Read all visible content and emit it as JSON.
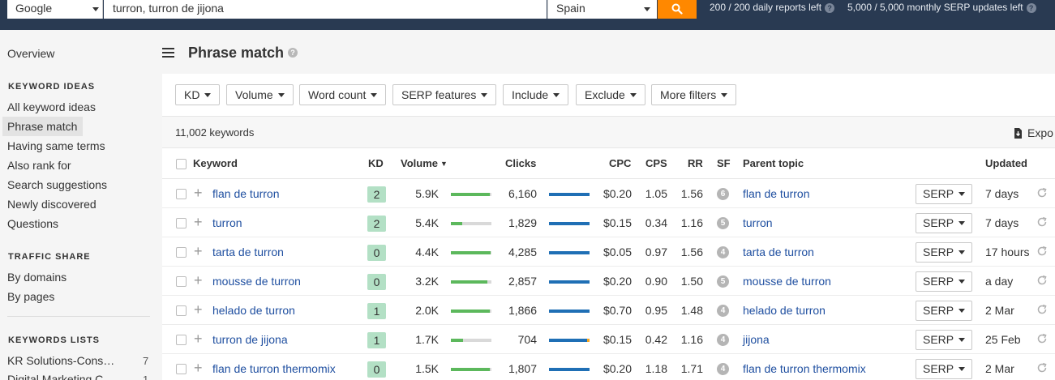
{
  "topbar": {
    "engine": "Google",
    "query": "turron, turron de jijona",
    "country": "Spain",
    "daily_reports": "200 / 200 daily reports left",
    "monthly_updates": "5,000 / 5,000 monthly SERP updates left",
    "help_mark": "?"
  },
  "sidebar": {
    "overview": "Overview",
    "keyword_ideas_heading": "KEYWORD IDEAS",
    "keyword_ideas": [
      "All keyword ideas",
      "Phrase match",
      "Having same terms",
      "Also rank for",
      "Search suggestions",
      "Newly discovered",
      "Questions"
    ],
    "active_item": "Phrase match",
    "traffic_share_heading": "TRAFFIC SHARE",
    "traffic_share": [
      "By domains",
      "By pages"
    ],
    "keyword_lists_heading": "KEYWORDS LISTS",
    "keyword_lists": [
      {
        "name": "KR Solutions-Cons…",
        "count": "7"
      },
      {
        "name": "Digital Marketing C…",
        "count": "1"
      }
    ]
  },
  "page": {
    "title": "Phrase match",
    "help_mark": "?"
  },
  "filters": [
    "KD",
    "Volume",
    "Word count",
    "SERP features",
    "Include",
    "Exclude",
    "More filters"
  ],
  "results": {
    "count": "11,002 keywords",
    "export_label": "Expo"
  },
  "table": {
    "headers": {
      "keyword": "Keyword",
      "kd": "KD",
      "volume": "Volume",
      "clicks": "Clicks",
      "cpc": "CPC",
      "cps": "CPS",
      "rr": "RR",
      "sf": "SF",
      "parent_topic": "Parent topic",
      "updated": "Updated"
    },
    "serp_label": "SERP",
    "rows": [
      {
        "keyword": "flan de turron",
        "kd": "2",
        "volume": "5.9K",
        "volume_level": 0.96,
        "clicks": "6,160",
        "paid_share": 0.0,
        "cpc": "$0.20",
        "cps": "1.05",
        "rr": "1.56",
        "sf": "6",
        "parent": "flan de turron",
        "updated": "7 days"
      },
      {
        "keyword": "turron",
        "kd": "2",
        "volume": "5.4K",
        "volume_level": 0.27,
        "clicks": "1,829",
        "paid_share": 0.0,
        "cpc": "$0.15",
        "cps": "0.34",
        "rr": "1.16",
        "sf": "5",
        "parent": "turron",
        "updated": "7 days"
      },
      {
        "keyword": "tarta de turron",
        "kd": "0",
        "volume": "4.4K",
        "volume_level": 0.97,
        "clicks": "4,285",
        "paid_share": 0.0,
        "cpc": "$0.05",
        "cps": "0.97",
        "rr": "1.56",
        "sf": "4",
        "parent": "tarta de turron",
        "updated": "17 hours"
      },
      {
        "keyword": "mousse de turron",
        "kd": "0",
        "volume": "3.2K",
        "volume_level": 0.89,
        "clicks": "2,857",
        "paid_share": 0.0,
        "cpc": "$0.20",
        "cps": "0.90",
        "rr": "1.50",
        "sf": "5",
        "parent": "mousse de turron",
        "updated": "a day"
      },
      {
        "keyword": "helado de turron",
        "kd": "1",
        "volume": "2.0K",
        "volume_level": 0.95,
        "clicks": "1,866",
        "paid_share": 0.0,
        "cpc": "$0.70",
        "cps": "0.95",
        "rr": "1.48",
        "sf": "4",
        "parent": "helado de turron",
        "updated": "2 Mar"
      },
      {
        "keyword": "turron de jijona",
        "kd": "1",
        "volume": "1.7K",
        "volume_level": 0.3,
        "clicks": "704",
        "paid_share": 0.06,
        "cpc": "$0.15",
        "cps": "0.42",
        "rr": "1.16",
        "sf": "4",
        "parent": "jijona",
        "updated": "25 Feb"
      },
      {
        "keyword": "flan de turron thermomix",
        "kd": "0",
        "volume": "1.5K",
        "volume_level": 0.96,
        "clicks": "1,807",
        "paid_share": 0.0,
        "cpc": "$0.20",
        "cps": "1.18",
        "rr": "1.71",
        "sf": "4",
        "parent": "flan de turron thermomix",
        "updated": "2 Mar"
      }
    ]
  },
  "colors": {
    "topbar": "#293a52",
    "search_button": "#ff8800",
    "link": "#1f4fa0",
    "kd_badge": "#b3e0c5",
    "volume_bar": "#5cb85c",
    "clicks_bar": "#1f6fb5",
    "paid_clicks": "#f5a623"
  }
}
